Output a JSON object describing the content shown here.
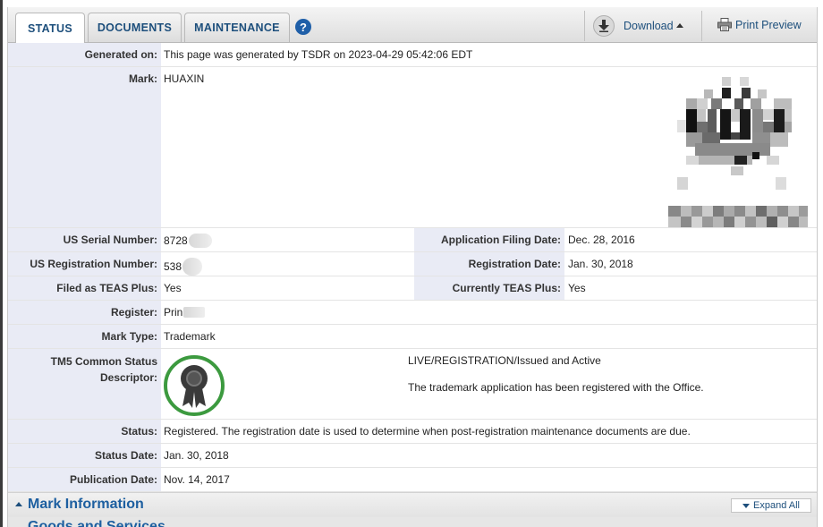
{
  "tabs": [
    {
      "label": "STATUS",
      "active": true
    },
    {
      "label": "DOCUMENTS",
      "active": false
    },
    {
      "label": "MAINTENANCE",
      "active": false
    }
  ],
  "toolbar": {
    "help_icon": "question-circle-icon",
    "help_glyph": "?",
    "download_label": "Download",
    "print_label": "Print Preview"
  },
  "fields": {
    "generated_on": {
      "label": "Generated on:",
      "value": "This page was generated by TSDR on 2023-04-29 05:42:06 EDT"
    },
    "mark": {
      "label": "Mark:",
      "value": "HUAXIN"
    },
    "serial": {
      "label": "US Serial Number:",
      "value": "8728"
    },
    "filing_date": {
      "label": "Application Filing Date:",
      "value": "Dec. 28, 2016"
    },
    "registration_number": {
      "label": "US Registration Number:",
      "value": "538"
    },
    "registration_date": {
      "label": "Registration Date:",
      "value": "Jan. 30, 2018"
    },
    "filed_teas_plus": {
      "label": "Filed as TEAS Plus:",
      "value": "Yes"
    },
    "current_teas_plus": {
      "label": "Currently TEAS Plus:",
      "value": "Yes"
    },
    "register": {
      "label": "Register:",
      "value": "Prin"
    },
    "mark_type": {
      "label": "Mark Type:",
      "value": "Trademark"
    },
    "tm5": {
      "label_line1": "TM5 Common Status",
      "label_line2": "Descriptor:",
      "status_line": "LIVE/REGISTRATION/Issued and Active",
      "description": "The trademark application has been registered with the Office."
    },
    "status": {
      "label": "Status:",
      "value": "Registered. The registration date is used to determine when post-registration maintenance documents are due."
    },
    "status_date": {
      "label": "Status Date:",
      "value": "Jan. 30, 2018"
    },
    "publication_date": {
      "label": "Publication Date:",
      "value": "Nov. 14, 2017"
    }
  },
  "sections": {
    "mark_information": "Mark Information",
    "expand_all": "Expand All",
    "goods_services": "Goods and Services"
  },
  "colors": {
    "link_blue": "#1d4f7c",
    "label_bg": "#e9ebf5",
    "badge_green": "#3c9a3f"
  }
}
